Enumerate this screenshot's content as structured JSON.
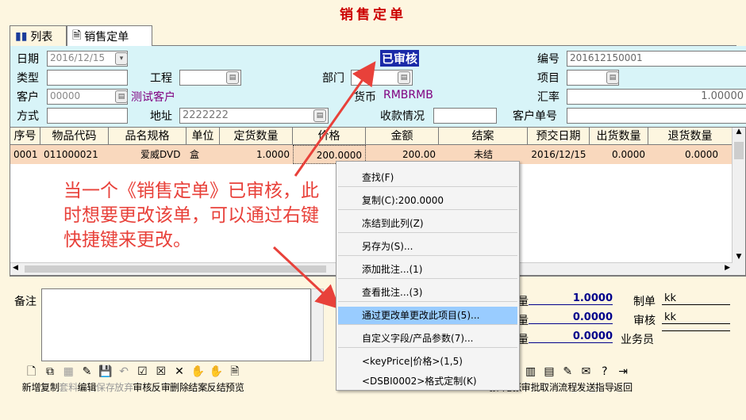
{
  "title": "销售定单",
  "tabs": [
    {
      "label": "列表",
      "icon": "chart-icon"
    },
    {
      "label": "销售定单",
      "icon": "form-icon"
    }
  ],
  "header": {
    "date_label": "日期",
    "date_value": "2016/12/15",
    "status": "已审核",
    "number_label": "编号",
    "number_value": "201612150001",
    "type_label": "类型",
    "project_label": "工程",
    "dept_label": "部门",
    "item_label": "项目",
    "customer_label": "客户",
    "customer_value": "00000",
    "customer_name": "测试客户",
    "currency_label": "货币",
    "currency_value": "RMBRMB",
    "rate_label": "汇率",
    "rate_value": "1.00000",
    "method_label": "方式",
    "address_label": "地址",
    "address_value": "2222222",
    "receipt_label": "收款情况",
    "custno_label": "客户单号"
  },
  "grid": {
    "columns": [
      "序号",
      "物品代码",
      "品名规格",
      "单位",
      "定货数量",
      "价格",
      "金额",
      "结案",
      "预交日期",
      "出货数量",
      "退货数量"
    ],
    "rows": [
      [
        "0001",
        "011000021",
        "爱威DVD",
        "盒",
        "1.0000",
        "200.0000",
        "200.00",
        "未结",
        "2016/12/15",
        "0.0000",
        "0.0000"
      ]
    ]
  },
  "notes_label": "备注",
  "summary": {
    "values": [
      "1.0000",
      "0.0000",
      "0.0000"
    ],
    "prefix": "量"
  },
  "side": {
    "maker_label": "制单",
    "maker_value": "kk",
    "auditor_label": "审核",
    "auditor_value": "kk",
    "sales_label": "业务员"
  },
  "context_menu": [
    "查找(F)",
    "复制(C):200.0000",
    "冻结到此列(Z)",
    "另存为(S)...",
    "添加批注...(1)",
    "查看批注...(3)",
    "通过更改单更改此项目(5)...",
    "自定义字段/产品参数(7)...",
    "<keyPrice|价格>(1,5)",
    "<DSBI0002>格式定制(K)"
  ],
  "annotation": "当一个《销售定单》已审核，此时想要更改该单，可以通过右键快捷键来更改。",
  "toolbar": [
    {
      "label": "新增",
      "icon": "new-icon"
    },
    {
      "label": "复制",
      "icon": "copy-icon"
    },
    {
      "label": "套料",
      "icon": "material-icon",
      "disabled": true
    },
    {
      "label": "编辑",
      "icon": "edit-icon"
    },
    {
      "label": "保存",
      "icon": "save-icon",
      "disabled": true
    },
    {
      "label": "放弃",
      "icon": "undo-icon",
      "disabled": true
    },
    {
      "label": "审核",
      "icon": "audit-icon"
    },
    {
      "label": "反审",
      "icon": "unaudit-icon"
    },
    {
      "label": "删除",
      "icon": "delete-icon"
    },
    {
      "label": "结案",
      "icon": "close-case-icon"
    },
    {
      "label": "反结",
      "icon": "reopen-icon"
    },
    {
      "label": "预览",
      "icon": "preview-icon"
    },
    {
      "label": "",
      "icon": "blank-icon"
    },
    {
      "label": "",
      "icon": "blank-icon"
    },
    {
      "label": "",
      "icon": "blank-icon"
    },
    {
      "label": "",
      "icon": "blank-icon"
    },
    {
      "label": "",
      "icon": "blank-icon"
    },
    {
      "label": "",
      "icon": "blank-icon"
    },
    {
      "label": "",
      "icon": "blank-icon"
    },
    {
      "label": "",
      "icon": "blank-icon"
    },
    {
      "label": "",
      "icon": "blank-icon"
    },
    {
      "label": "",
      "icon": "blank-icon"
    },
    {
      "label": "",
      "icon": "blank-icon"
    },
    {
      "label": "",
      "icon": "blank-icon"
    },
    {
      "label": "",
      "icon": "blank-icon"
    },
    {
      "label": "张",
      "icon": "prev-icon"
    },
    {
      "label": "尾张",
      "icon": "last-icon"
    },
    {
      "label": "审批",
      "icon": "approve-icon"
    },
    {
      "label": "取消",
      "icon": "cancel-icon"
    },
    {
      "label": "流程",
      "icon": "flow-icon"
    },
    {
      "label": "发送",
      "icon": "send-icon"
    },
    {
      "label": "指导",
      "icon": "help-icon"
    },
    {
      "label": "返回",
      "icon": "exit-icon"
    }
  ]
}
